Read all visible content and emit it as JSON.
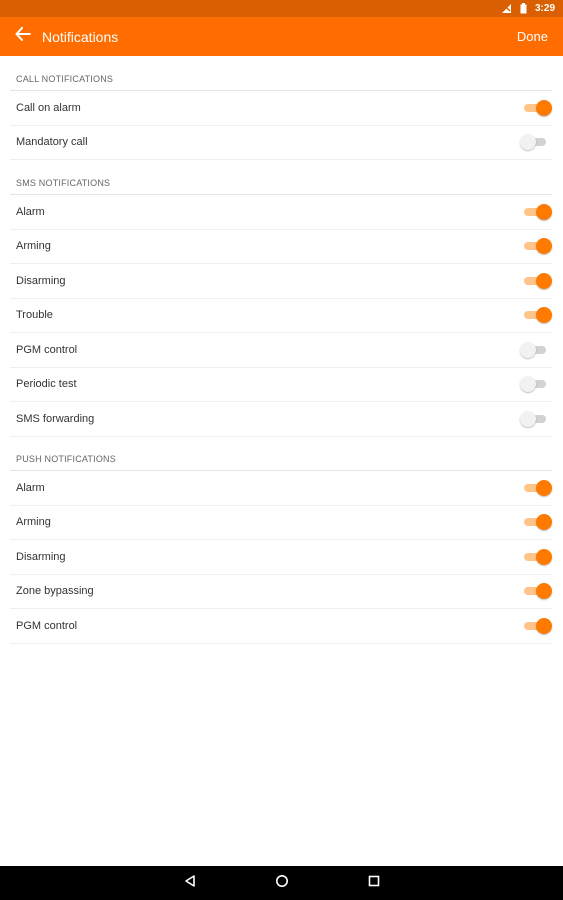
{
  "status_bar": {
    "time": "3:29"
  },
  "app_bar": {
    "title": "Notifications",
    "done_label": "Done"
  },
  "sections": [
    {
      "title": "CALL NOTIFICATIONS",
      "rows": [
        {
          "label": "Call on alarm",
          "on": true
        },
        {
          "label": "Mandatory call",
          "on": false
        }
      ]
    },
    {
      "title": "SMS NOTIFICATIONS",
      "rows": [
        {
          "label": "Alarm",
          "on": true
        },
        {
          "label": "Arming",
          "on": true
        },
        {
          "label": "Disarming",
          "on": true
        },
        {
          "label": "Trouble",
          "on": true
        },
        {
          "label": "PGM control",
          "on": false
        },
        {
          "label": "Periodic test",
          "on": false
        },
        {
          "label": "SMS forwarding",
          "on": false
        }
      ]
    },
    {
      "title": "PUSH NOTIFICATIONS",
      "rows": [
        {
          "label": "Alarm",
          "on": true
        },
        {
          "label": "Arming",
          "on": true
        },
        {
          "label": "Disarming",
          "on": true
        },
        {
          "label": "Zone bypassing",
          "on": true
        },
        {
          "label": "PGM control",
          "on": true
        }
      ]
    }
  ],
  "colors": {
    "accent": "#ff6d00",
    "status_bar": "#d95f00",
    "toggle_on": "#ff7a00"
  },
  "icons": {
    "back": "arrow-left-icon",
    "nav": [
      "back-triangle-icon",
      "home-circle-icon",
      "recents-square-icon"
    ]
  }
}
